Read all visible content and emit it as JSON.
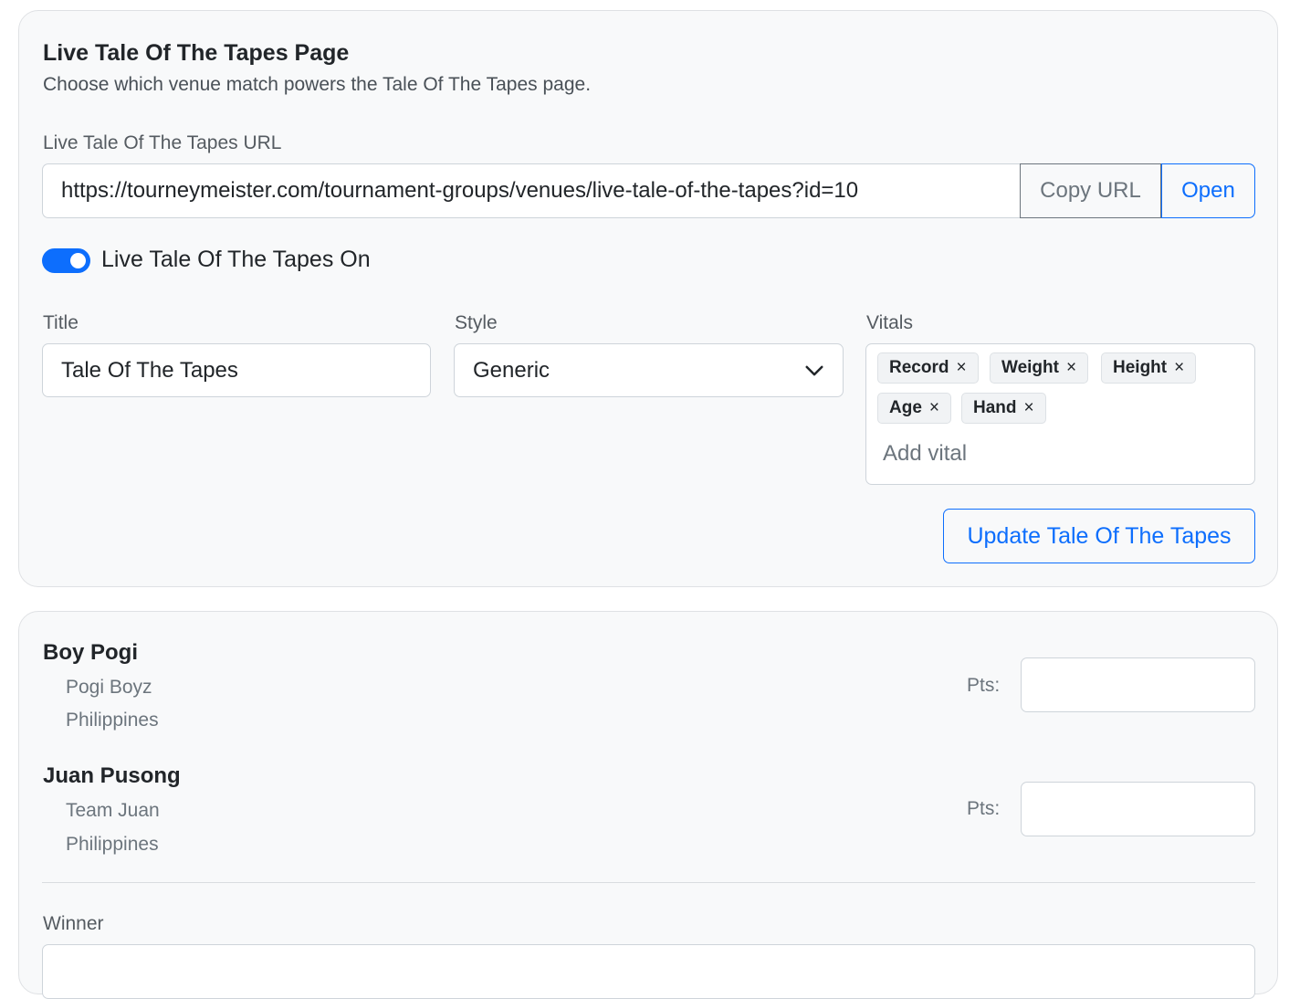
{
  "settings": {
    "title": "Live Tale Of The Tapes Page",
    "subtitle": "Choose which venue match powers the Tale Of The Tapes page.",
    "url_label": "Live Tale Of The Tapes URL",
    "url_value": "https://tourneymeister.com/tournament-groups/venues/live-tale-of-the-tapes?id=10",
    "copy_label": "Copy URL",
    "open_label": "Open",
    "toggle_label": "Live Tale Of The Tapes On",
    "toggle_on": true,
    "accent_color": "#0d6efd",
    "title_label": "Title",
    "title_value": "Tale Of The Tapes",
    "style_label": "Style",
    "style_value": "Generic",
    "vitals_label": "Vitals",
    "vitals": [
      "Record",
      "Weight",
      "Height",
      "Age",
      "Hand"
    ],
    "vital_remove_glyph": "×",
    "add_vital_placeholder": "Add vital",
    "update_label": "Update Tale Of The Tapes"
  },
  "match": {
    "fighters": [
      {
        "name": "Boy Pogi",
        "team": "Pogi Boyz",
        "country": "Philippines",
        "pts_label": "Pts:",
        "pts_value": ""
      },
      {
        "name": "Juan Pusong",
        "team": "Team Juan",
        "country": "Philippines",
        "pts_label": "Pts:",
        "pts_value": ""
      }
    ],
    "winner_label": "Winner"
  }
}
